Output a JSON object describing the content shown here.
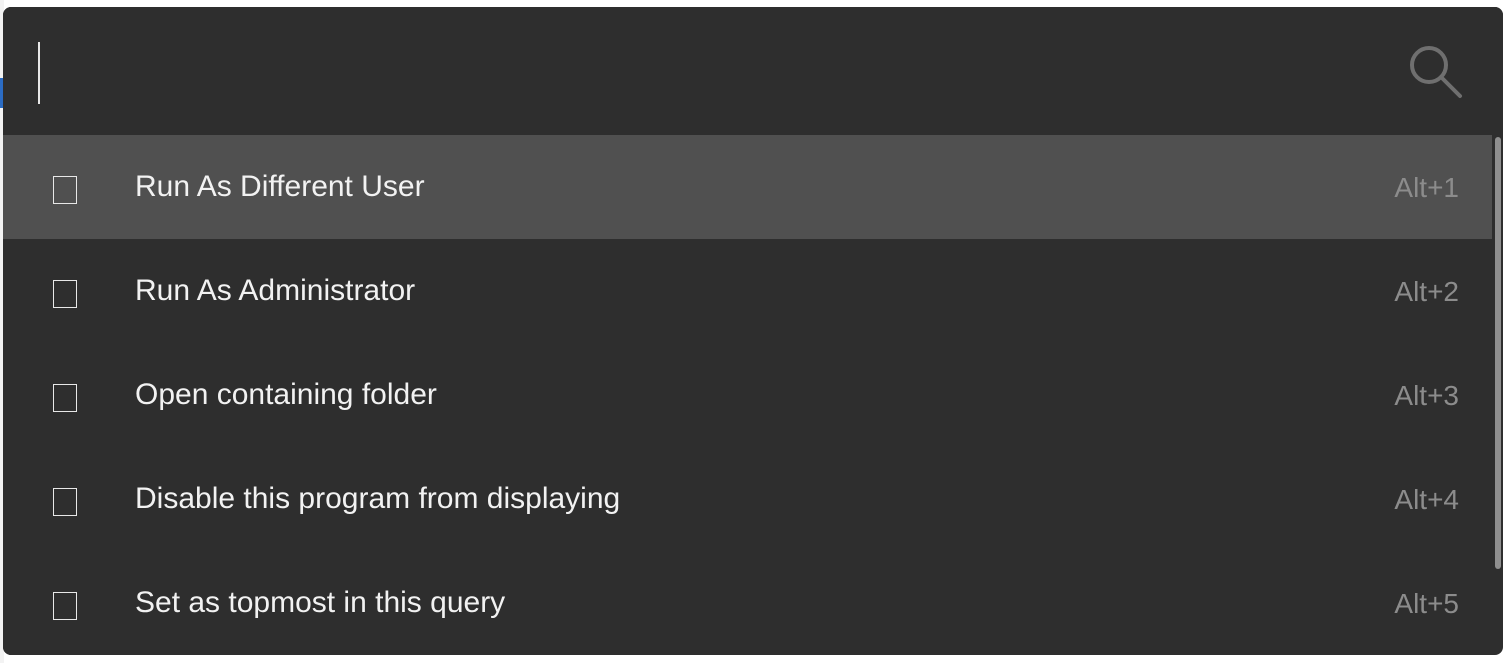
{
  "search": {
    "value": "",
    "placeholder": ""
  },
  "icons": {
    "search": "search-icon",
    "result_item": "program-icon"
  },
  "results": [
    {
      "title": "Run As Different User",
      "hotkey": "Alt+1",
      "selected": true
    },
    {
      "title": "Run As Administrator",
      "hotkey": "Alt+2",
      "selected": false
    },
    {
      "title": "Open containing folder",
      "hotkey": "Alt+3",
      "selected": false
    },
    {
      "title": "Disable this program from displaying",
      "hotkey": "Alt+4",
      "selected": false
    },
    {
      "title": "Set as topmost in this query",
      "hotkey": "Alt+5",
      "selected": false
    }
  ],
  "colors": {
    "background": "#2e2e2e",
    "selected_row": "#505050",
    "text": "#f2f2f2",
    "hotkey_text": "#8c8c8c"
  }
}
